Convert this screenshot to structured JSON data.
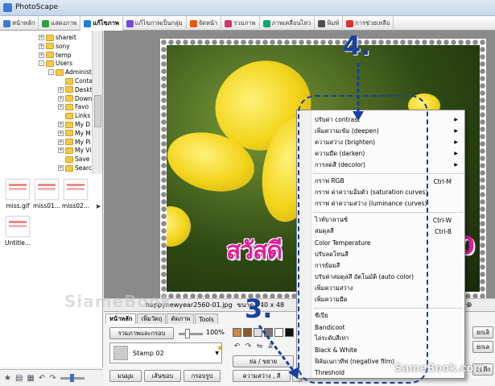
{
  "window": {
    "title": "PhotoScape"
  },
  "tabs": [
    {
      "label": "หน้าหลัก",
      "color": "#3a7bd5"
    },
    {
      "label": "แสดงภาพ",
      "color": "#2f9e44"
    },
    {
      "label": "แก้ไขภาพ",
      "color": "#1c7ed6",
      "active": true
    },
    {
      "label": "แก้ไขภาพเป็นกลุ่ม",
      "color": "#7048e8"
    },
    {
      "label": "จัดหน้า",
      "color": "#e8590c"
    },
    {
      "label": "รวมภาพ",
      "color": "#d6336c"
    },
    {
      "label": "ภาพเคลื่อนไหว",
      "color": "#0ca678"
    },
    {
      "label": "พิมพ์",
      "color": "#495057"
    },
    {
      "label": "การช่วยเหลือ",
      "color": "#e03131"
    }
  ],
  "tree": {
    "items": [
      {
        "label": "shareit",
        "expander": "+"
      },
      {
        "label": "sony",
        "expander": "+"
      },
      {
        "label": "temp",
        "expander": "+"
      },
      {
        "label": "Users",
        "expander": "-"
      },
      {
        "label": "Administ",
        "expander": "-"
      },
      {
        "label": "Conta",
        "expander": ""
      },
      {
        "label": "Deskto",
        "expander": "+"
      },
      {
        "label": "Down",
        "expander": "+"
      },
      {
        "label": "Favo",
        "expander": "+"
      },
      {
        "label": "Links",
        "expander": ""
      },
      {
        "label": "My D",
        "expander": "+"
      },
      {
        "label": "My M",
        "expander": "+"
      },
      {
        "label": "My Pi",
        "expander": "+"
      },
      {
        "label": "My Vi",
        "expander": "+"
      },
      {
        "label": "Save",
        "expander": ""
      },
      {
        "label": "Searc",
        "expander": "+"
      }
    ]
  },
  "thumbnails": [
    {
      "label": "miss.gif"
    },
    {
      "label": "miss01..."
    },
    {
      "label": "miss02..."
    },
    {
      "label": "Untitle..."
    }
  ],
  "image": {
    "greeting": "สวัสดี",
    "greeting_tail": "0",
    "watermark": "com"
  },
  "status": {
    "filename": "happynewyear2560-01.jpg",
    "dimensions": "ขนาด 640 x 48",
    "zoom": "5%",
    "zoom_in": "⊕"
  },
  "edit_panel": {
    "tabs": [
      {
        "label": "หน้าหลัก",
        "active": true
      },
      {
        "label": "เพิ่มวัตถุ"
      },
      {
        "label": "ตัดภาพ"
      },
      {
        "label": "Tools"
      }
    ],
    "frame_button": "รวมภาพและกรอบ",
    "frame_percent": "100%",
    "stamp_label": "Stamp 02",
    "resize_button": "ย่อ / ขยาย",
    "brightness_button": "ความสว่าง , สี",
    "round_button": "มนมุม",
    "border_button": "เส้นขอบ",
    "frame2_button": "กรอบรูป",
    "side_buttons": [
      "ยกเลิ",
      "ยกเล",
      "บันทึก"
    ]
  },
  "menu": {
    "items": [
      {
        "label": "ปรับค่า contrast",
        "submenu": true
      },
      {
        "label": "เพิ่มความเข้ม (deepen)",
        "submenu": true
      },
      {
        "label": "ความสว่าง (brighten)",
        "submenu": true
      },
      {
        "label": "ความมืด (darken)",
        "submenu": true
      },
      {
        "label": "การลดสี (decolor)",
        "submenu": true
      },
      {
        "separator": true
      },
      {
        "label": "กราฟ RGB",
        "shortcut": "Ctrl-M"
      },
      {
        "label": "กราฟ ค่าความอิ่มตัว (saturation curves)"
      },
      {
        "label": "กราฟ ค่าความสว่าง (luminance curves)"
      },
      {
        "separator": true
      },
      {
        "label": "ไวท์บาลานซ์",
        "shortcut": "Ctrl-W"
      },
      {
        "label": "สมดุลสี",
        "shortcut": "Ctrl-B"
      },
      {
        "label": "Color Temperature"
      },
      {
        "label": "ปรับลดโทนสี"
      },
      {
        "label": "การย้อมสี"
      },
      {
        "label": "ปรับค่าสมดุลสี อัตโนมัติ (auto color)"
      },
      {
        "label": "เพิ่มความสว่าง"
      },
      {
        "label": "เพิ่มความมืด"
      },
      {
        "separator": true
      },
      {
        "label": "ซีเปีย"
      },
      {
        "label": "Bandicoot"
      },
      {
        "label": "ไล่ระดับสีเทา"
      },
      {
        "label": "Black & White"
      },
      {
        "label": "ฟิล์มเนกาทีฟ (negative film)"
      },
      {
        "label": "Threshold"
      }
    ]
  },
  "callouts": {
    "step3": "3.",
    "step4": "4."
  },
  "logos": {
    "bottom_right": "SameBook.com",
    "bottom_left": "SiameBook"
  }
}
